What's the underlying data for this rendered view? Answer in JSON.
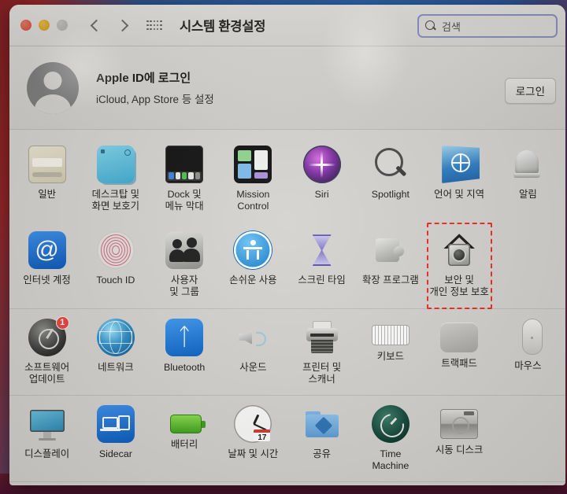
{
  "window": {
    "title": "시스템 환경설정",
    "traffic_lights": [
      "close",
      "minimize",
      "zoom"
    ],
    "nav": {
      "back": "back-chevron",
      "forward": "forward-chevron",
      "show_all": "show-all-grid"
    },
    "search": {
      "placeholder": "검색",
      "value": "",
      "icon": "search-icon"
    }
  },
  "apple_id": {
    "title": "Apple ID에 로그인",
    "subtitle": "iCloud, App Store 등 설정",
    "sign_in_label": "로그인",
    "avatar": "person-avatar-icon"
  },
  "highlight": {
    "color": "#ef2b24",
    "target": "보안 및\n개인 정보 보호"
  },
  "rows": [
    {
      "separator": false,
      "panes": [
        {
          "label": "일반",
          "icon": "general-icon",
          "badge": ""
        },
        {
          "label": "데스크탑 및\n화면 보호기",
          "icon": "desktop-screensaver-icon",
          "badge": ""
        },
        {
          "label": "Dock 및\n메뉴 막대",
          "icon": "dock-menubar-icon",
          "badge": ""
        },
        {
          "label": "Mission\nControl",
          "icon": "mission-control-icon",
          "badge": ""
        },
        {
          "label": "Siri",
          "icon": "siri-icon",
          "badge": ""
        },
        {
          "label": "Spotlight",
          "icon": "spotlight-icon",
          "badge": ""
        },
        {
          "label": "언어 및 지역",
          "icon": "language-region-flag-icon",
          "badge": ""
        },
        {
          "label": "알림",
          "icon": "notifications-bell-icon",
          "badge": ""
        }
      ]
    },
    {
      "separator": true,
      "panes": [
        {
          "label": "인터넷 계정",
          "icon": "internet-accounts-at-icon",
          "badge": ""
        },
        {
          "label": "Touch ID",
          "icon": "touch-id-fingerprint-icon",
          "badge": ""
        },
        {
          "label": "사용자\n및 그룹",
          "icon": "users-groups-icon",
          "badge": ""
        },
        {
          "label": "손쉬운 사용",
          "icon": "accessibility-icon",
          "badge": ""
        },
        {
          "label": "스크린 타임",
          "icon": "screen-time-hourglass-icon",
          "badge": ""
        },
        {
          "label": "확장 프로그램",
          "icon": "extensions-puzzle-icon",
          "badge": ""
        },
        {
          "label": "보안 및\n개인 정보 보호",
          "icon": "security-privacy-house-lock-icon",
          "badge": "",
          "highlighted": true
        },
        {
          "label": "",
          "icon": "",
          "badge": ""
        }
      ]
    },
    {
      "separator": true,
      "panes": [
        {
          "label": "소프트웨어\n업데이트",
          "icon": "software-update-icon",
          "badge": "1"
        },
        {
          "label": "네트워크",
          "icon": "network-globe-icon",
          "badge": ""
        },
        {
          "label": "Bluetooth",
          "icon": "bluetooth-icon",
          "badge": ""
        },
        {
          "label": "사운드",
          "icon": "sound-speaker-icon",
          "badge": ""
        },
        {
          "label": "프린터 및\n스캐너",
          "icon": "printers-scanners-icon",
          "badge": ""
        },
        {
          "label": "키보드",
          "icon": "keyboard-icon",
          "badge": ""
        },
        {
          "label": "트랙패드",
          "icon": "trackpad-icon",
          "badge": ""
        },
        {
          "label": "마우스",
          "icon": "mouse-icon",
          "badge": ""
        }
      ]
    },
    {
      "separator": true,
      "panes": [
        {
          "label": "디스플레이",
          "icon": "displays-icon",
          "badge": ""
        },
        {
          "label": "Sidecar",
          "icon": "sidecar-icon",
          "badge": ""
        },
        {
          "label": "배터리",
          "icon": "battery-icon",
          "badge": ""
        },
        {
          "label": "날짜 및 시간",
          "icon": "date-time-clock-icon",
          "badge": "",
          "clock_day": "17"
        },
        {
          "label": "공유",
          "icon": "sharing-folder-icon",
          "badge": ""
        },
        {
          "label": "Time\nMachine",
          "icon": "time-machine-icon",
          "badge": ""
        },
        {
          "label": "시동 디스크",
          "icon": "startup-disk-icon",
          "badge": ""
        },
        {
          "label": "",
          "icon": "",
          "badge": ""
        }
      ]
    }
  ]
}
